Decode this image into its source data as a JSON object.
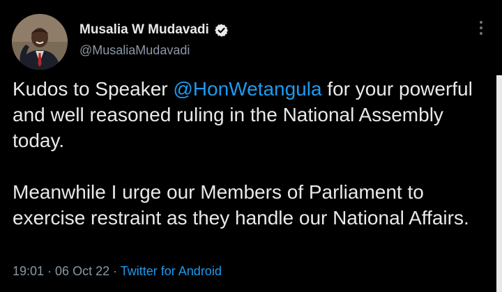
{
  "tweet": {
    "author": {
      "display_name": "Musalia W Mudavadi",
      "handle": "@MusaliaMudavadi",
      "verified_icon": "verified-badge-icon"
    },
    "body": {
      "para1_before": "Kudos to Speaker ",
      "mention": "@HonWetangula",
      "para1_after": " for your powerful and well reasoned ruling in the National Assembly today.",
      "para2": "Meanwhile I urge our Members of Parliament to exercise restraint as they handle our National Affairs."
    },
    "meta": {
      "time": "19:01",
      "separator": " · ",
      "date": "06 Oct 22",
      "separator2": " · ",
      "source": "Twitter for Android"
    },
    "more_icon": "more-options-icon"
  },
  "colors": {
    "background": "#000000",
    "text": "#e7e9ea",
    "secondary": "#8b98a5",
    "accent": "#1d9bf0"
  }
}
